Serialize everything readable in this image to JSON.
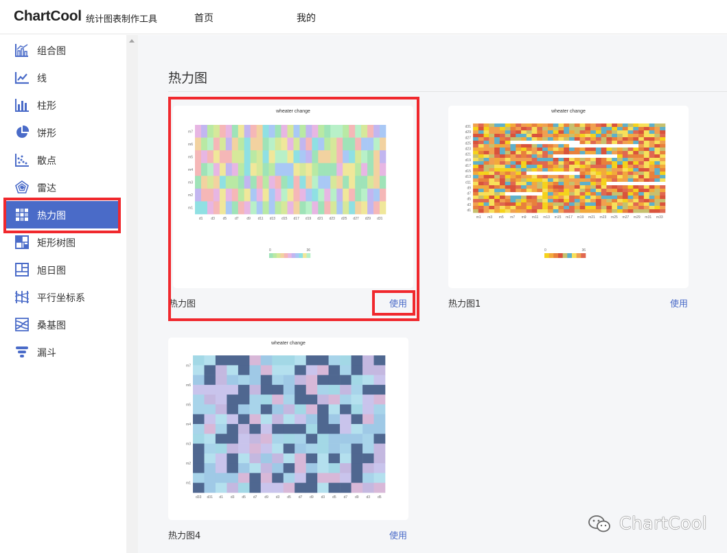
{
  "header": {
    "brand": "ChartCool",
    "tagline": "统计图表制作工具",
    "nav": [
      "首页",
      "我的"
    ]
  },
  "sidebar": {
    "items": [
      {
        "label": "组合图",
        "icon": "combo-chart-icon"
      },
      {
        "label": "线",
        "icon": "line-chart-icon"
      },
      {
        "label": "柱形",
        "icon": "bar-chart-icon"
      },
      {
        "label": "饼形",
        "icon": "pie-chart-icon"
      },
      {
        "label": "散点",
        "icon": "scatter-chart-icon"
      },
      {
        "label": "雷达",
        "icon": "radar-chart-icon"
      },
      {
        "label": "热力图",
        "icon": "heatmap-icon",
        "active": true
      },
      {
        "label": "矩形树图",
        "icon": "treemap-icon"
      },
      {
        "label": "旭日图",
        "icon": "sunburst-icon"
      },
      {
        "label": "平行坐标系",
        "icon": "parallel-coords-icon"
      },
      {
        "label": "桑基图",
        "icon": "sankey-icon"
      },
      {
        "label": "漏斗",
        "icon": "funnel-icon"
      }
    ]
  },
  "main": {
    "title": "热力图",
    "cards": [
      {
        "label": "热力图",
        "use": "使用",
        "chart_title": "wheater change",
        "scale_min": "0",
        "scale_max": "36",
        "y_labels": [
          "m7",
          "m6",
          "m5",
          "m4",
          "m3",
          "m2",
          "m1"
        ],
        "x_labels": [
          "d1",
          "d3",
          "d5",
          "d7",
          "d9",
          "d11",
          "d13",
          "d15",
          "d17",
          "d19",
          "d21",
          "d23",
          "d25",
          "d27",
          "d29",
          "d31"
        ]
      },
      {
        "label": "热力图1",
        "use": "使用",
        "chart_title": "wheater change",
        "scale_min": "0",
        "scale_max": "36",
        "y_labels": [
          "d31",
          "d29",
          "d27",
          "d25",
          "d23",
          "d21",
          "d19",
          "d17",
          "d15",
          "d13",
          "d11",
          "d9",
          "d7",
          "d5",
          "d3",
          "d1"
        ],
        "x_labels": [
          "m1",
          "m3",
          "m5",
          "m7",
          "m9",
          "m11",
          "m13",
          "m15",
          "m17",
          "m19",
          "m21",
          "m23",
          "m25",
          "m27",
          "m29",
          "m31",
          "m33"
        ]
      },
      {
        "label": "热力图4",
        "use": "使用",
        "chart_title": "wheater change",
        "y_labels": [
          "m7",
          "m6",
          "m5",
          "m4",
          "m3",
          "m2",
          "m1"
        ],
        "x_labels": [
          "d33",
          "d31",
          "d1",
          "d3",
          "d5",
          "d7",
          "d9",
          "d3",
          "d5",
          "d7",
          "d9",
          "d3",
          "d5",
          "d7",
          "d9",
          "d3",
          "d5"
        ]
      }
    ]
  },
  "watermark": {
    "text": "ChartCool",
    "icon": "wechat-icon"
  },
  "colors": {
    "accent": "#4a6bc8",
    "highlight": "#f0282d"
  }
}
